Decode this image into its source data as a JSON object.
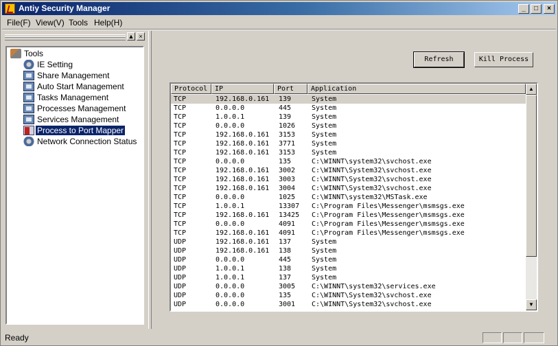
{
  "window": {
    "title": "Antiy Security Manager",
    "minimize": "_",
    "maximize": "□",
    "close": "×"
  },
  "menu": [
    "File(F)",
    "View(V)",
    "Tools",
    "Help(H)"
  ],
  "pane": {
    "pin": "▲",
    "close": "×"
  },
  "tree": {
    "root": "Tools",
    "items": [
      {
        "label": "IE Setting",
        "icon": "ie-setting-icon"
      },
      {
        "label": "Share Management",
        "icon": "share-management-icon"
      },
      {
        "label": "Auto Start Management",
        "icon": "auto-start-icon"
      },
      {
        "label": "Tasks Management",
        "icon": "tasks-icon"
      },
      {
        "label": "Processes Management",
        "icon": "processes-icon"
      },
      {
        "label": "Services Management",
        "icon": "services-icon"
      },
      {
        "label": "Process to Port Mapper",
        "icon": "port-mapper-icon",
        "selected": true
      },
      {
        "label": "Network Connection Status",
        "icon": "network-status-icon"
      }
    ]
  },
  "buttons": {
    "refresh": "Refresh",
    "kill": "Kill Process"
  },
  "table": {
    "columns": [
      "Protocol",
      "IP",
      "Port",
      "Application"
    ],
    "rows": [
      [
        "TCP",
        "192.168.0.161",
        "139",
        "System"
      ],
      [
        "TCP",
        "0.0.0.0",
        "445",
        "System"
      ],
      [
        "TCP",
        "1.0.0.1",
        "139",
        "System"
      ],
      [
        "TCP",
        "0.0.0.0",
        "1026",
        "System"
      ],
      [
        "TCP",
        "192.168.0.161",
        "3153",
        "System"
      ],
      [
        "TCP",
        "192.168.0.161",
        "3771",
        "System"
      ],
      [
        "TCP",
        "192.168.0.161",
        "3153",
        "System"
      ],
      [
        "TCP",
        "0.0.0.0",
        "135",
        "C:\\WINNT\\system32\\svchost.exe"
      ],
      [
        "TCP",
        "192.168.0.161",
        "3002",
        "C:\\WINNT\\System32\\svchost.exe"
      ],
      [
        "TCP",
        "192.168.0.161",
        "3003",
        "C:\\WINNT\\System32\\svchost.exe"
      ],
      [
        "TCP",
        "192.168.0.161",
        "3004",
        "C:\\WINNT\\System32\\svchost.exe"
      ],
      [
        "TCP",
        "0.0.0.0",
        "1025",
        "C:\\WINNT\\system32\\MSTask.exe"
      ],
      [
        "TCP",
        "1.0.0.1",
        "13307",
        "C:\\Program Files\\Messenger\\msmsgs.exe"
      ],
      [
        "TCP",
        "192.168.0.161",
        "13425",
        "C:\\Program Files\\Messenger\\msmsgs.exe"
      ],
      [
        "TCP",
        "0.0.0.0",
        "4091",
        "C:\\Program Files\\Messenger\\msmsgs.exe"
      ],
      [
        "TCP",
        "192.168.0.161",
        "4091",
        "C:\\Program Files\\Messenger\\msmsgs.exe"
      ],
      [
        "UDP",
        "192.168.0.161",
        "137",
        "System"
      ],
      [
        "UDP",
        "192.168.0.161",
        "138",
        "System"
      ],
      [
        "UDP",
        "0.0.0.0",
        "445",
        "System"
      ],
      [
        "UDP",
        "1.0.0.1",
        "138",
        "System"
      ],
      [
        "UDP",
        "1.0.0.1",
        "137",
        "System"
      ],
      [
        "UDP",
        "0.0.0.0",
        "3005",
        "C:\\WINNT\\system32\\services.exe"
      ],
      [
        "UDP",
        "0.0.0.0",
        "135",
        "C:\\WINNT\\System32\\svchost.exe"
      ],
      [
        "UDP",
        "0.0.0.0",
        "3001",
        "C:\\WINNT\\System32\\svchost.exe"
      ]
    ],
    "selected_row": 0
  },
  "scrollbar": {
    "up": "▲",
    "down": "▼"
  },
  "status": {
    "text": "Ready"
  },
  "colors": {
    "title_active": "#0a246a",
    "face": "#d4d0c8",
    "selection": "#0a246a"
  }
}
